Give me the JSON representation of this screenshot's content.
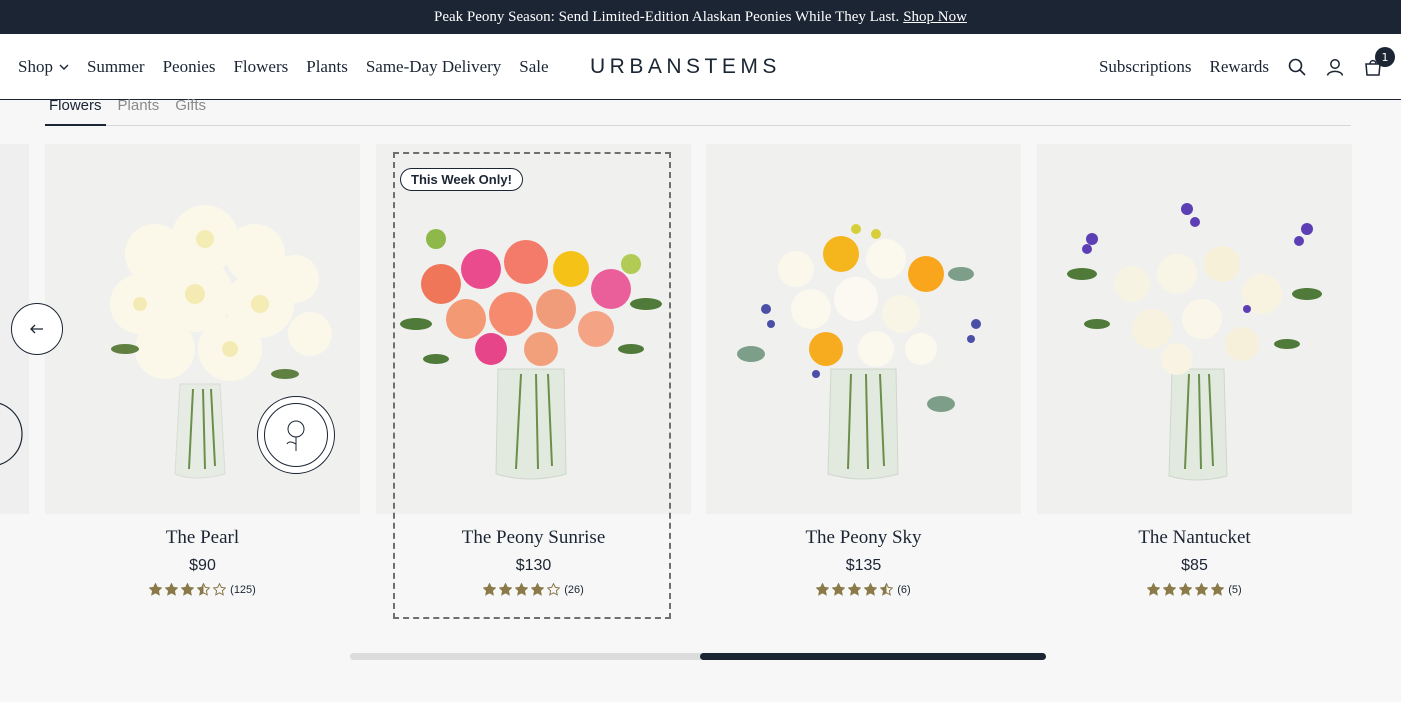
{
  "announcement": {
    "text": "Peak Peony Season: Send Limited-Edition Alaskan Peonies While They Last.",
    "link": "Shop Now"
  },
  "nav": {
    "left": [
      {
        "label": "Shop",
        "has_dropdown": true
      },
      {
        "label": "Summer"
      },
      {
        "label": "Peonies"
      },
      {
        "label": "Flowers"
      },
      {
        "label": "Plants"
      },
      {
        "label": "Same-Day Delivery"
      },
      {
        "label": "Sale"
      }
    ],
    "logo": "URBANSTEMS",
    "right": [
      {
        "label": "Subscriptions"
      },
      {
        "label": "Rewards"
      }
    ],
    "cart_count": "1",
    "icons": [
      "search-icon",
      "account-icon",
      "cart-icon"
    ]
  },
  "tabs": [
    {
      "label": "Flowers",
      "active": true
    },
    {
      "label": "Plants"
    },
    {
      "label": "Gifts"
    }
  ],
  "products": [
    {
      "name": "The Pearl",
      "price": "$90",
      "rating": 3.5,
      "reviews": "(125)",
      "stamp": "ARRIVES IN BUD FORM"
    },
    {
      "name": "The Peony Sunrise",
      "price": "$130",
      "rating": 4,
      "reviews": "(26)",
      "badge": "This Week Only!"
    },
    {
      "name": "The Peony Sky",
      "price": "$135",
      "rating": 4.5,
      "reviews": "(6)"
    },
    {
      "name": "The Nantucket",
      "price": "$85",
      "rating": 5,
      "reviews": "(5)"
    }
  ],
  "carousel": {
    "scroll_position_fraction": 0.5
  },
  "colors": {
    "navy": "#1b2533",
    "star": "#8a7a4a",
    "card_bg": "#efefef"
  }
}
